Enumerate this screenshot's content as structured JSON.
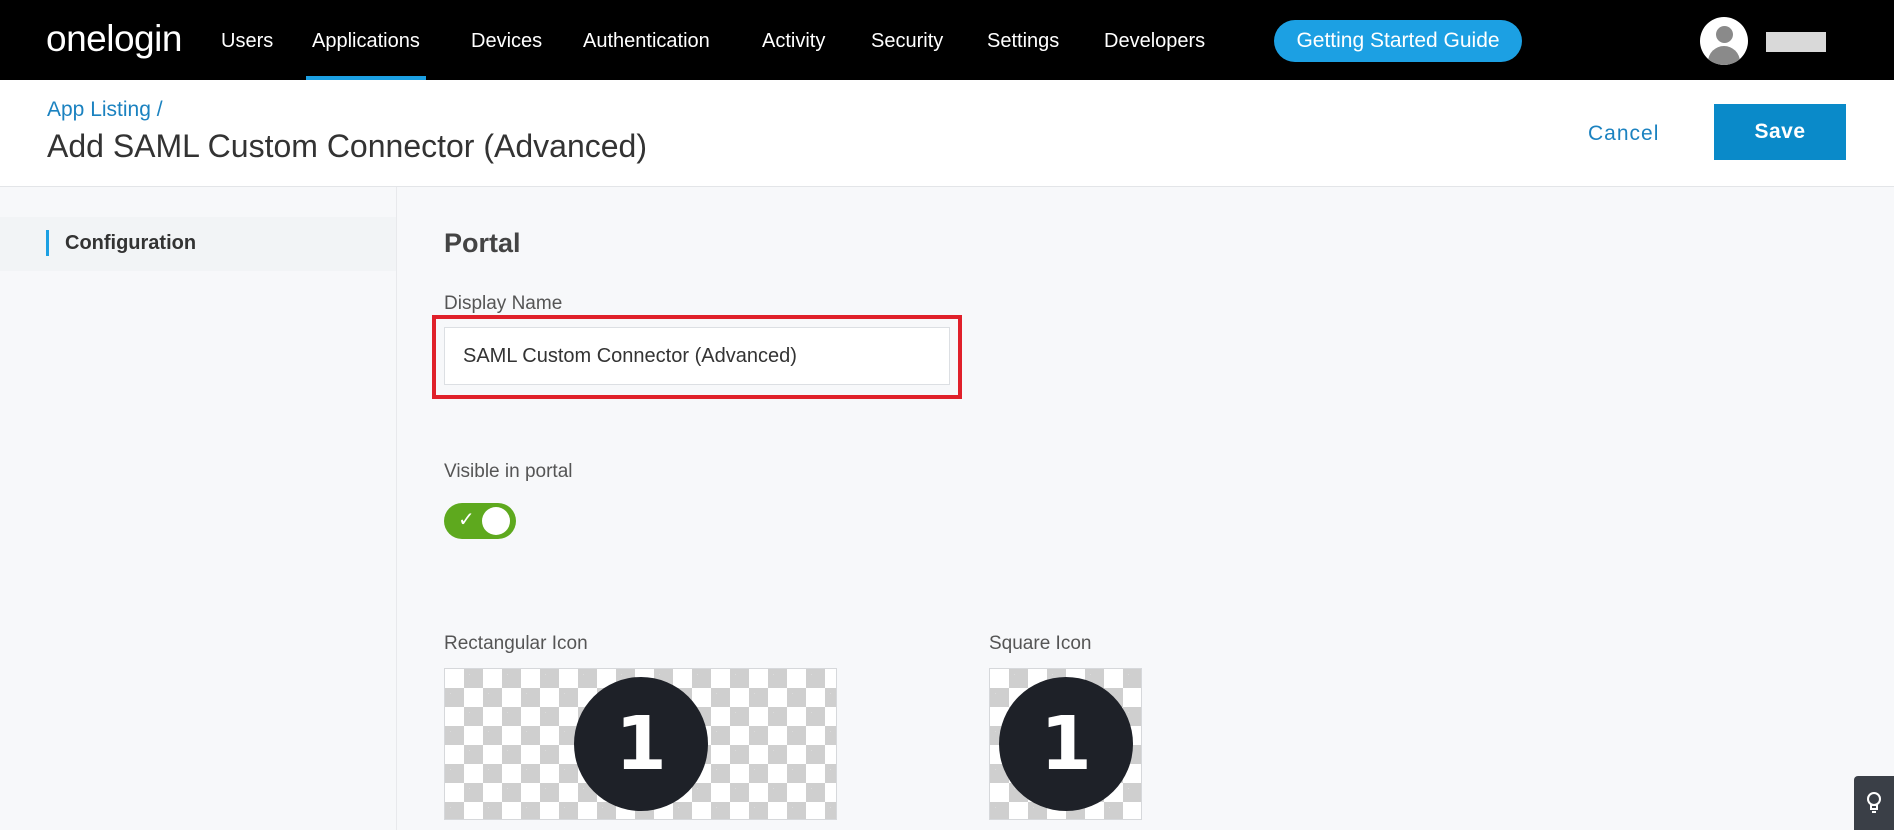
{
  "nav": {
    "logo": "onelogin",
    "items": [
      {
        "label": "Users"
      },
      {
        "label": "Applications",
        "active": true
      },
      {
        "label": "Devices"
      },
      {
        "label": "Authentication"
      },
      {
        "label": "Activity"
      },
      {
        "label": "Security"
      },
      {
        "label": "Settings"
      },
      {
        "label": "Developers"
      }
    ],
    "guide_button": "Getting Started Guide",
    "avatar_icon": "user-avatar-icon"
  },
  "header": {
    "breadcrumb": "App Listing /",
    "title": "Add SAML Custom Connector (Advanced)",
    "cancel_label": "Cancel",
    "save_label": "Save"
  },
  "sidebar": {
    "items": [
      {
        "label": "Configuration",
        "active": true
      }
    ]
  },
  "main": {
    "section_title": "Portal",
    "display_name": {
      "label": "Display Name",
      "value": "SAML Custom Connector (Advanced)"
    },
    "visible_in_portal": {
      "label": "Visible in portal",
      "checked": true
    },
    "rect_icon": {
      "label": "Rectangular Icon",
      "glyph": "1"
    },
    "square_icon": {
      "label": "Square Icon",
      "glyph": "1"
    }
  },
  "colors": {
    "accent": "#1ca0e3",
    "save_button": "#0a8ac9",
    "toggle_on": "#5ea91e",
    "highlight": "#e0202a"
  },
  "help": {
    "icon": "lightbulb-icon"
  }
}
